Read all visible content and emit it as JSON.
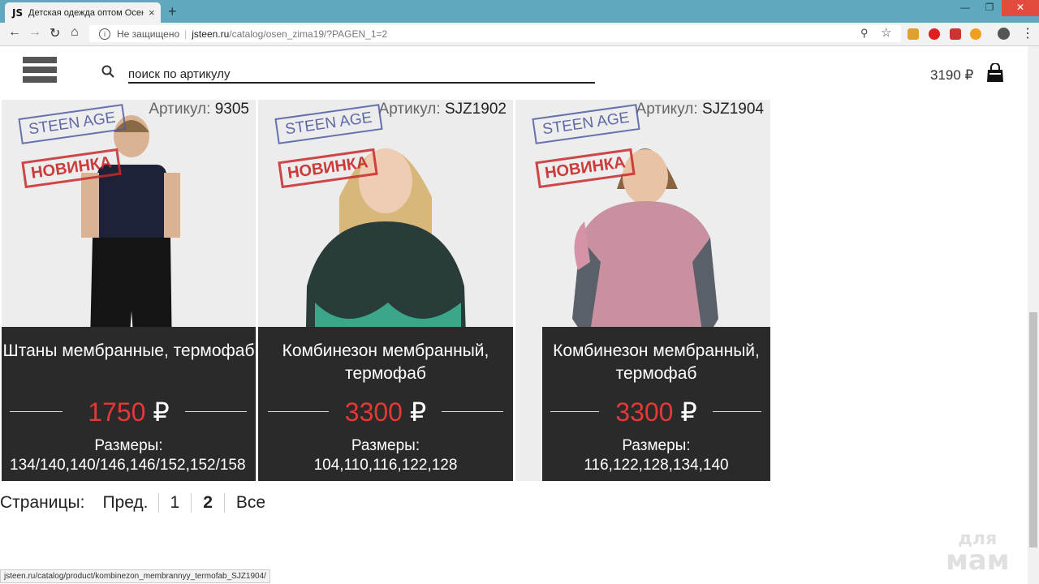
{
  "browser": {
    "tab_logo": "JS",
    "tab_title": "Детская одежда оптом Осень-З",
    "tab_close": "×",
    "new_tab": "+",
    "window": {
      "minimize": "—",
      "restore": "❐",
      "close": "✕"
    },
    "security_label": "Не защищено",
    "url_host": "jsteen.ru",
    "url_path": "/catalog/osen_zima19/?PAGEN_1=2"
  },
  "header": {
    "search_placeholder": "поиск по артикулу",
    "cart_total": "3190 ₽"
  },
  "products": [
    {
      "article_label": "Артикул:",
      "article": "9305",
      "badge_brand": "STEEN AGE",
      "badge_new": "НОВИНКА",
      "name": "Штаны мембранные, термофаб",
      "price": "1750",
      "currency": "₽",
      "sizes_label": "Размеры:",
      "sizes": "134/140,140/146,146/152,152/158"
    },
    {
      "article_label": "Артикул:",
      "article": "SJZ1902",
      "badge_brand": "STEEN AGE",
      "badge_new": "НОВИНКА",
      "name": "Комбинезон мембранный, термофаб",
      "price": "3300",
      "currency": "₽",
      "sizes_label": "Размеры:",
      "sizes": "104,110,116,122,128"
    },
    {
      "article_label": "Артикул:",
      "article": "SJZ1904",
      "badge_brand": "STEEN AGE",
      "badge_new": "НОВИНКА",
      "name": "Комбинезон мембранный, термофаб",
      "price": "3300",
      "currency": "₽",
      "sizes_label": "Размеры:",
      "sizes": "116,122,128,134,140"
    }
  ],
  "pagination": {
    "label": "Страницы:",
    "prev": "Пред.",
    "pages": [
      "1",
      "2"
    ],
    "current": "2",
    "all": "Все"
  },
  "status_url": "jsteen.ru/catalog/product/kombinezon_membrannyy_termofab_SJZ1904/",
  "watermark": {
    "line1": "для",
    "line2": "мам"
  },
  "colors": {
    "price": "#e53935",
    "info_bg": "#2a2a2a",
    "tabbar": "#5fa8bd"
  }
}
